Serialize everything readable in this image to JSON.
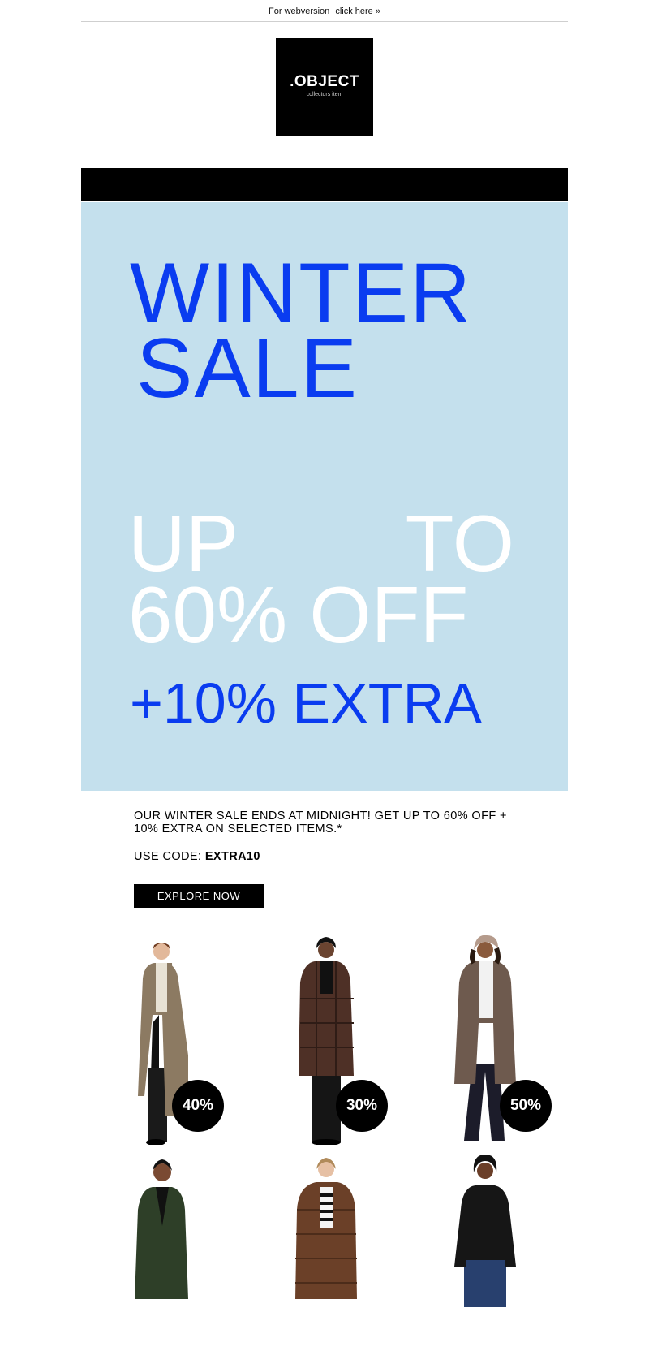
{
  "topbar": {
    "text": "For webversion",
    "link": "click here »"
  },
  "logo": {
    "main": ".OBJECT",
    "sub": "collectors item"
  },
  "hero": {
    "title_line1": "WINTER",
    "title_line2": "SALE",
    "offer_up": "UP",
    "offer_to": "TO",
    "offer_line2": "60% OFF",
    "extra": "+10% EXTRA"
  },
  "body": {
    "copy": "OUR WINTER SALE ENDS AT MIDNIGHT! GET UP TO 60% OFF + 10% EXTRA ON SELECTED ITEMS.*",
    "code_label": "USE CODE:",
    "code_value": "EXTRA10",
    "cta": "EXPLORE NOW"
  },
  "products": [
    {
      "badge": "40%",
      "item": "long beige cardigan"
    },
    {
      "badge": "30%",
      "item": "brown checked coat"
    },
    {
      "badge": "50%",
      "item": "brown wool coat"
    },
    {
      "badge": "",
      "item": "green blazer"
    },
    {
      "badge": "",
      "item": "brown puffer jacket"
    },
    {
      "badge": "",
      "item": "black blouse"
    }
  ],
  "colors": {
    "hero_bg": "#c4e0ed",
    "accent_blue": "#0a3cf0",
    "black": "#000000",
    "white": "#ffffff"
  }
}
